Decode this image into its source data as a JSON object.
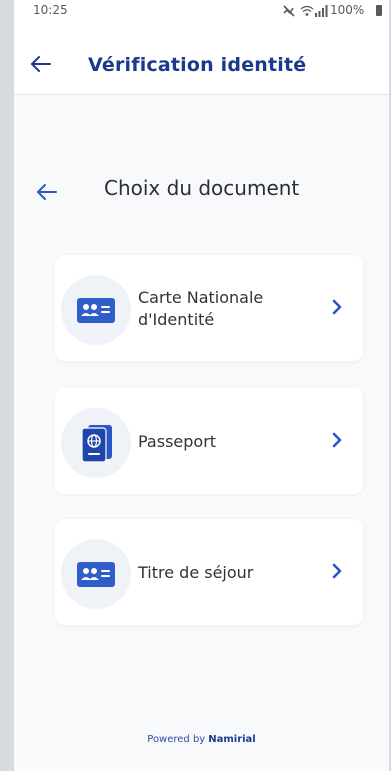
{
  "status_bar": {
    "time": "10:25",
    "battery": "100%",
    "icons": [
      "mute-icon",
      "wifi-icon",
      "signal-icon",
      "battery-icon"
    ]
  },
  "header": {
    "back_icon": "arrow-left-icon",
    "title": "Vérification identité"
  },
  "content": {
    "back_icon": "arrow-left-icon",
    "title": "Choix du document"
  },
  "documents": [
    {
      "label_line1": "Carte Nationale",
      "label_line2": "d'Identité",
      "icon": "id-card-icon"
    },
    {
      "label": "Passeport",
      "icon": "passport-icon"
    },
    {
      "label": "Titre de séjour",
      "icon": "id-card-icon"
    }
  ],
  "footer": {
    "prefix": "Powered by",
    "brand": "Namirial"
  },
  "colors": {
    "primary": "#1b3a8f",
    "accent": "#2a56c6",
    "text": "#2f333a",
    "background": "#f8f9fb",
    "card": "#ffffff"
  }
}
